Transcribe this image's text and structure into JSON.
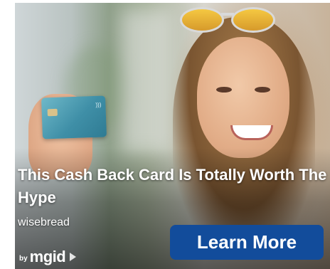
{
  "ad": {
    "headline": "This Cash Back Card Is Totally Worth The Hype",
    "source": "wisebread",
    "cta_label": "Learn More",
    "network": {
      "by_label": "by",
      "brand": "mgid",
      "icon": "play-icon"
    }
  },
  "colors": {
    "cta_background": "#124c9b",
    "text": "#ffffff"
  }
}
